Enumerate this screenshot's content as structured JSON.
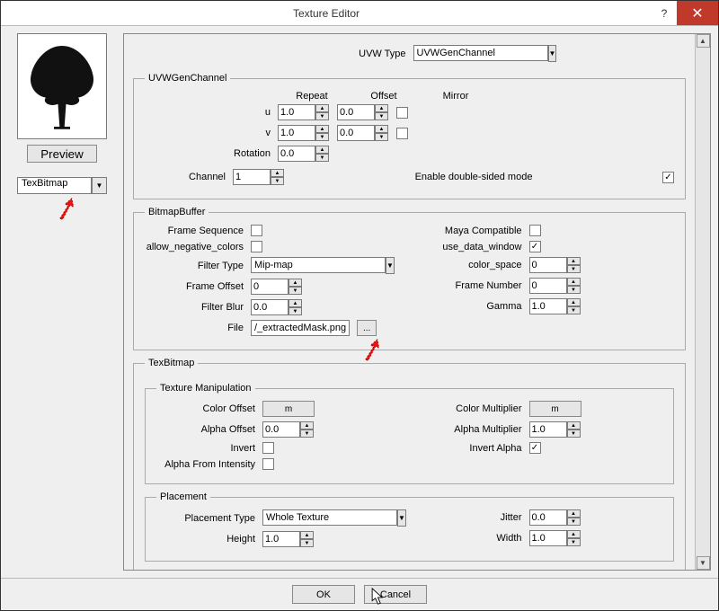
{
  "window": {
    "title": "Texture Editor",
    "help": "?",
    "close": "✕"
  },
  "left": {
    "preview": "Preview",
    "texType": "TexBitmap"
  },
  "top": {
    "label": "UVW Type",
    "value": "UVWGenChannel"
  },
  "uvw": {
    "legend": "UVWGenChannel",
    "cols": {
      "repeat": "Repeat",
      "offset": "Offset",
      "mirror": "Mirror"
    },
    "u": {
      "label": "u",
      "repeat": "1.0",
      "offset": "0.0"
    },
    "v": {
      "label": "v",
      "repeat": "1.0",
      "offset": "0.0"
    },
    "rotation": {
      "label": "Rotation",
      "value": "0.0"
    },
    "channel": {
      "label": "Channel",
      "value": "1"
    },
    "doubleSided": "Enable double-sided mode"
  },
  "buf": {
    "legend": "BitmapBuffer",
    "frameSequence": "Frame Sequence",
    "allowNeg": "allow_negative_colors",
    "filterType": {
      "label": "Filter Type",
      "value": "Mip-map"
    },
    "frameOffset": {
      "label": "Frame Offset",
      "value": "0"
    },
    "filterBlur": {
      "label": "Filter Blur",
      "value": "0.0"
    },
    "file": {
      "label": "File",
      "value": "/_extractedMask.png",
      "browse": "..."
    },
    "mayaCompat": "Maya Compatible",
    "useDataWin": "use_data_window",
    "colorSpace": {
      "label": "color_space",
      "value": "0"
    },
    "frameNumber": {
      "label": "Frame Number",
      "value": "0"
    },
    "gamma": {
      "label": "Gamma",
      "value": "1.0"
    }
  },
  "tb": {
    "legend": "TexBitmap",
    "manipLegend": "Texture Manipulation",
    "colorOffset": {
      "label": "Color Offset",
      "btn": "m"
    },
    "alphaOffset": {
      "label": "Alpha Offset",
      "value": "0.0"
    },
    "invert": "Invert",
    "alphaFromInt": "Alpha From Intensity",
    "colorMult": {
      "label": "Color Multiplier",
      "btn": "m"
    },
    "alphaMult": {
      "label": "Alpha Multiplier",
      "value": "1.0"
    },
    "invertAlpha": "Invert Alpha",
    "placeLegend": "Placement",
    "placeType": {
      "label": "Placement Type",
      "value": "Whole Texture"
    },
    "height": {
      "label": "Height",
      "value": "1.0"
    },
    "jitter": {
      "label": "Jitter",
      "value": "0.0"
    },
    "width": {
      "label": "Width",
      "value": "1.0"
    }
  },
  "footer": {
    "ok": "OK",
    "cancel": "Cancel"
  }
}
